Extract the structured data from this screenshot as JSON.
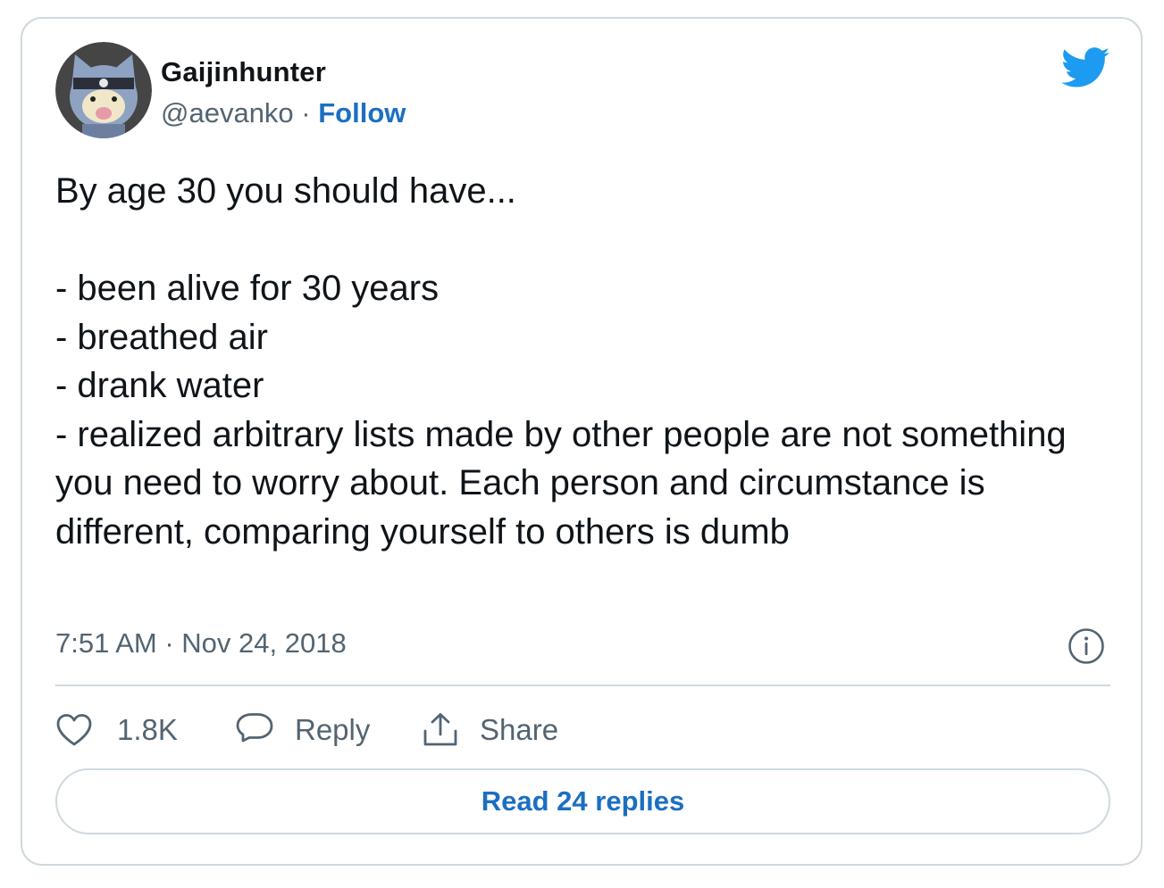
{
  "author": {
    "display_name": "Gaijinhunter",
    "handle": "@aevanko",
    "separator": " · ",
    "follow_label": "Follow",
    "avatar_icon": "ninja-cat-avatar"
  },
  "brand": {
    "logo_icon": "twitter-bird-icon",
    "accent_color": "#1d9bf0",
    "link_color": "#1b6fc2"
  },
  "tweet": {
    "text": "By age 30 you should have...\n\n- been alive for 30 years\n- breathed air\n- drank water\n- realized arbitrary lists made by other people are not something you need to worry about. Each person and circumstance is different, comparing yourself to others is dumb",
    "timestamp": "7:51 AM · Nov 24, 2018"
  },
  "actions": {
    "like_icon": "heart-icon",
    "like_count": "1.8K",
    "reply_icon": "speech-bubble-icon",
    "reply_label": "Reply",
    "share_icon": "share-upload-icon",
    "share_label": "Share",
    "info_icon": "info-icon"
  },
  "footer": {
    "read_replies_label": "Read 24 replies"
  }
}
